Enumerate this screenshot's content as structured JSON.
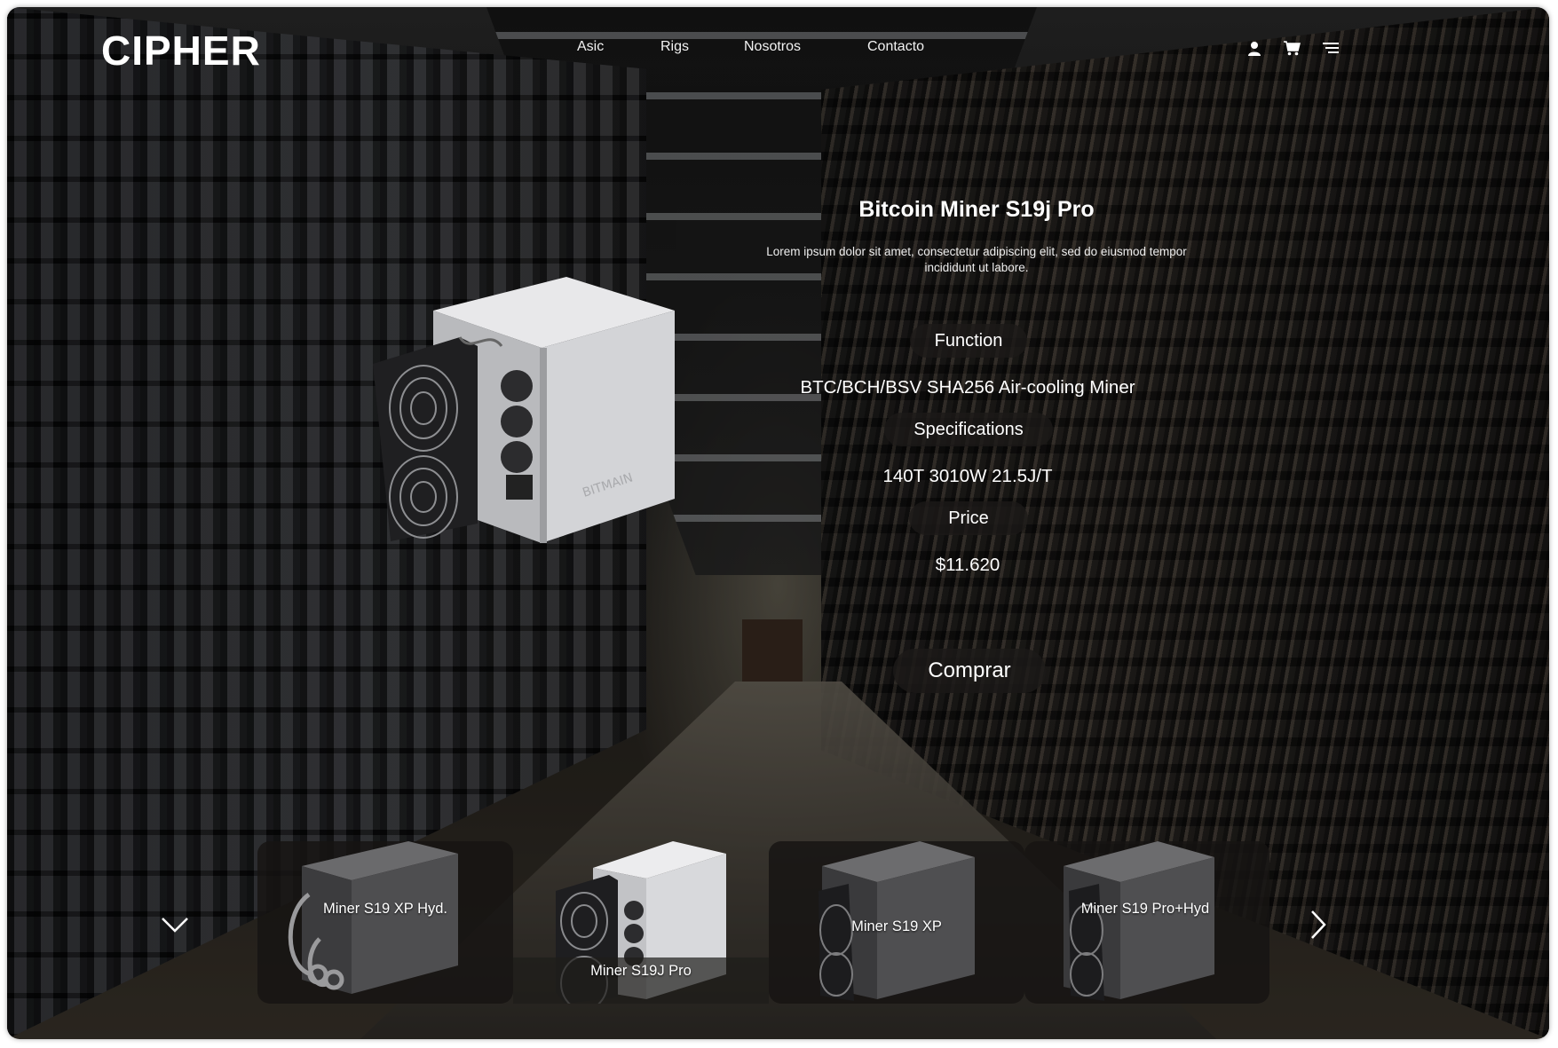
{
  "brand": {
    "logo": "CIPHER"
  },
  "nav": {
    "asic": "Asic",
    "rigs": "Rigs",
    "nosotros": "Nosotros",
    "contacto": "Contacto"
  },
  "header_icons": [
    "user-icon",
    "cart-icon",
    "menu-icon"
  ],
  "product": {
    "title": "Bitcoin Miner S19j Pro",
    "description": "Lorem ipsum dolor sit amet, consectetur adipiscing elit, sed do eiusmod tempor incididunt ut labore.",
    "function_label": "Function",
    "function_value": "BTC/BCH/BSV  SHA256  Air-cooling Miner",
    "specs_label": "Specifications",
    "specs_value": "140T 3010W 21.5J/T",
    "price_label": "Price",
    "price_value": "$11.620",
    "buy_label": "Comprar",
    "device_brand": "BITMAIN"
  },
  "carousel": {
    "items": [
      {
        "label": "Miner S19 XP Hyd."
      },
      {
        "label": "Miner S19J Pro"
      },
      {
        "label": "Miner S19 XP"
      },
      {
        "label": "Miner S19 Pro+Hyd"
      }
    ]
  },
  "colors": {
    "pill_bg": "#1c1a18",
    "text": "#ffffff",
    "card_bg": "#161412"
  }
}
